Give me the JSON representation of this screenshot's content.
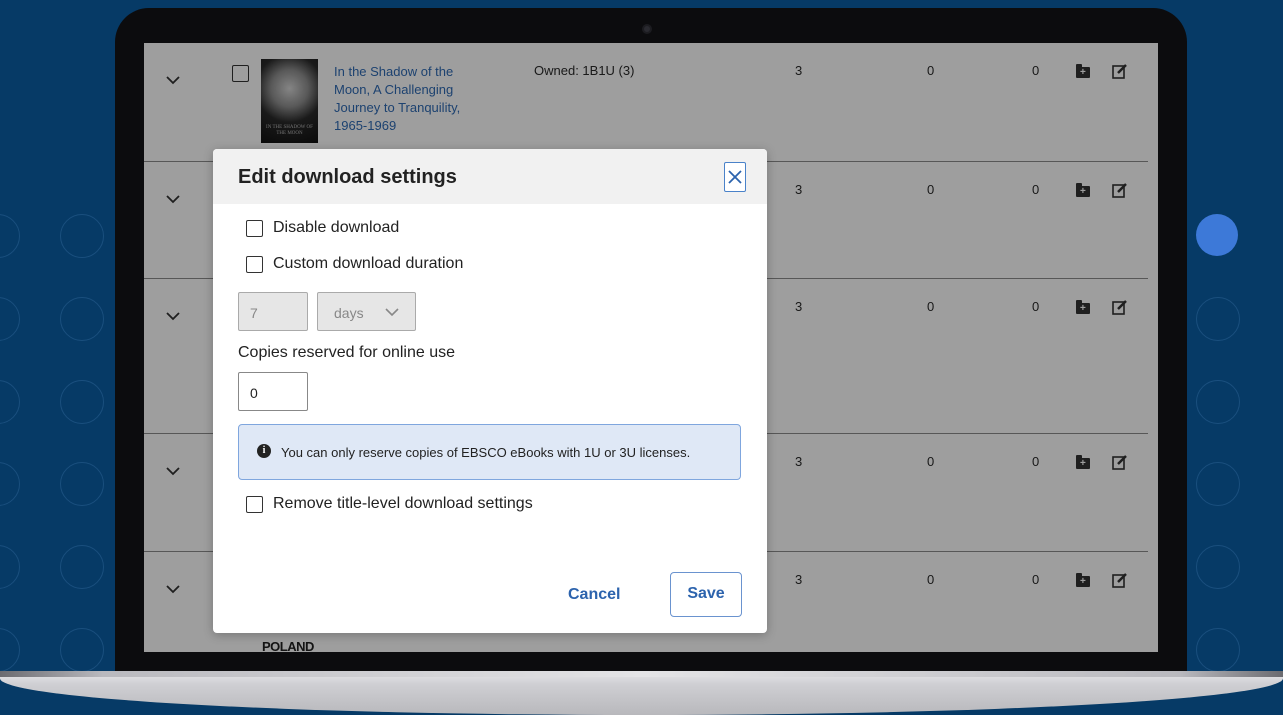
{
  "modal": {
    "title": "Edit download settings",
    "disable_download_label": "Disable download",
    "custom_duration_label": "Custom download duration",
    "duration_value": "7",
    "duration_unit": "days",
    "copies_label": "Copies reserved for online use",
    "copies_value": "0",
    "info_text": "You can only reserve copies of EBSCO eBooks with 1U or 3U licenses.",
    "remove_label": "Remove title-level download settings",
    "cancel_label": "Cancel",
    "save_label": "Save"
  },
  "rows": [
    {
      "title": "In the Shadow of the Moon, A Challenging Journey to Tranquility, 1965-1969",
      "owned": "Owned: 1B1U (3)",
      "col1": "3",
      "col2": "0",
      "col3": "0",
      "cover_text": "IN THE SHADOW OF THE MOON"
    },
    {
      "col1": "3",
      "col2": "0",
      "col3": "0"
    },
    {
      "col1": "3",
      "col2": "0",
      "col3": "0"
    },
    {
      "col1": "3",
      "col2": "0",
      "col3": "0"
    },
    {
      "col1": "3",
      "col2": "0",
      "col3": "0"
    }
  ],
  "partial_cover_text": "POLAND"
}
